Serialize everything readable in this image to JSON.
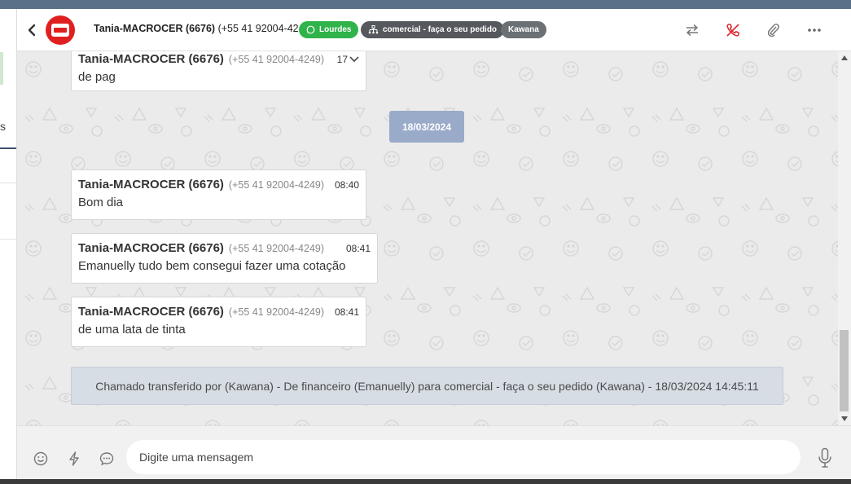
{
  "sidebar": {
    "partial_label": "s"
  },
  "header": {
    "contact_name": "Tania-MACROCER (6676)",
    "contact_phone": "(+55 41 92004-4249)",
    "tags": [
      {
        "label": "Lourdes",
        "color": "#2fb34a",
        "icon": "whatsapp-icon"
      },
      {
        "label": "comercial - faça o seu pedido",
        "color": "#55595e",
        "icon": "sitemap-icon"
      },
      {
        "label": "Kawana",
        "color": "#6b7075"
      }
    ],
    "actions": [
      "transfer-icon",
      "end-call-icon",
      "attachment-icon",
      "more-icon"
    ]
  },
  "messages": [
    {
      "sender": "Tania-MACROCER (6676)",
      "phone": "(+55 41 92004-4249)",
      "time": "17",
      "text": "de pag"
    },
    {
      "sender": "Tania-MACROCER (6676)",
      "phone": "(+55 41 92004-4249)",
      "time": "08:40",
      "text": "Bom dia"
    },
    {
      "sender": "Tania-MACROCER (6676)",
      "phone": "(+55 41 92004-4249)",
      "time": "08:41",
      "text": "Emanuelly tudo bem consegui fazer uma cotação"
    },
    {
      "sender": "Tania-MACROCER (6676)",
      "phone": "(+55 41 92004-4249)",
      "time": "08:41",
      "text": "de uma lata de tinta"
    }
  ],
  "date_divider": "18/03/2024",
  "system_message": "Chamado transferido por (Kawana) - De financeiro (Emanuelly) para comercial - faça o seu pedido (Kawana) - 18/03/2024 14:45:11",
  "composer": {
    "placeholder": "Digite uma mensagem",
    "icons": [
      "emoji-icon",
      "lightning-icon",
      "chat-bubble-icon",
      "microphone-icon"
    ]
  },
  "colors": {
    "header_bg": "#ffffff",
    "chat_bg": "#ebebeb",
    "date_pill": "#9aabc9",
    "system_bg": "#d7dde5",
    "end_call": "#d9262b"
  }
}
